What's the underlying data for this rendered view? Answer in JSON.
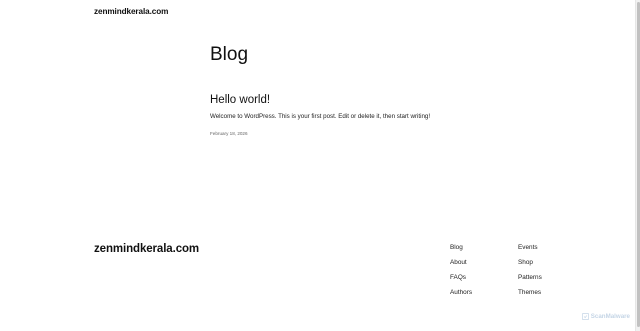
{
  "header": {
    "site_title": "zenmindkerala.com"
  },
  "main": {
    "page_title": "Blog",
    "posts": [
      {
        "title": "Hello world!",
        "excerpt": "Welcome to WordPress. This is your first post. Edit or delete it, then start writing!",
        "date": "February 18, 2026"
      }
    ]
  },
  "footer": {
    "site_title": "zenmindkerala.com",
    "nav_col1": [
      "Blog",
      "About",
      "FAQs",
      "Authors"
    ],
    "nav_col2": [
      "Events",
      "Shop",
      "Patterns",
      "Themes"
    ]
  },
  "watermark": {
    "text": "ScanMalware",
    "icon": "scanmalware-logo-icon"
  },
  "colors": {
    "text": "#111111",
    "muted": "#666666",
    "background": "#ffffff",
    "watermark": "#c5d5e6"
  }
}
